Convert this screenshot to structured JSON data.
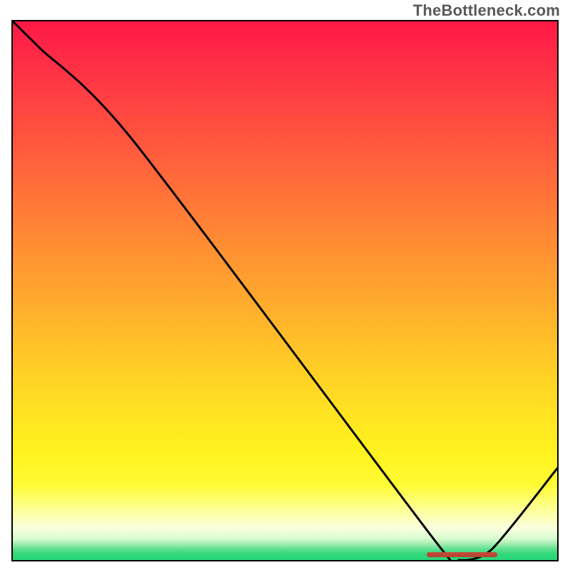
{
  "attribution": "TheBottleneck.com",
  "chart_data": {
    "type": "line",
    "title": "",
    "xlabel": "",
    "ylabel": "",
    "x": [
      0,
      5,
      22,
      78,
      82,
      88,
      100
    ],
    "values": [
      100,
      95,
      78,
      3,
      0,
      2,
      17
    ],
    "xlim": [
      0,
      100
    ],
    "ylim": [
      0,
      100
    ],
    "annotations": [
      {
        "kind": "min-region-marker",
        "x_start": 76,
        "x_end": 89,
        "y": 0,
        "color": "#c54b3a"
      }
    ],
    "background": {
      "type": "vertical-gradient",
      "stops": [
        {
          "pos": 0.0,
          "color": "#ff1846"
        },
        {
          "pos": 0.36,
          "color": "#ff7e36"
        },
        {
          "pos": 0.72,
          "color": "#ffe122"
        },
        {
          "pos": 0.94,
          "color": "#fbffde"
        },
        {
          "pos": 1.0,
          "color": "#27d67a"
        }
      ]
    }
  }
}
